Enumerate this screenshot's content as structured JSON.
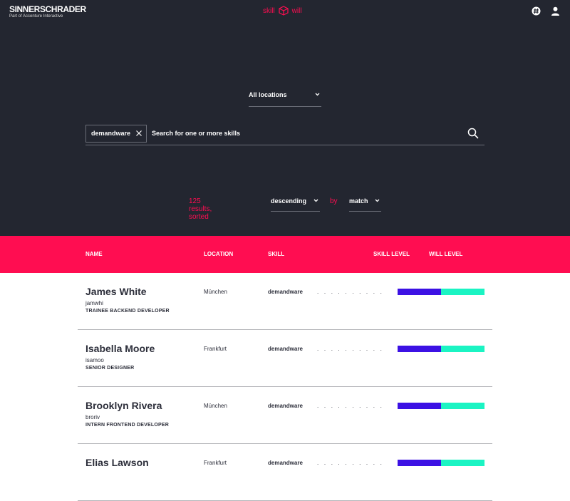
{
  "brand": {
    "name": "SINNERSCHRADER",
    "sub": "Part of Accenture Interactive"
  },
  "app_logo": {
    "left": "skill",
    "right": "will"
  },
  "filters": {
    "location": "All locations"
  },
  "search": {
    "tag": "demandware",
    "placeholder": "Search for one or more skills"
  },
  "results": {
    "count_text": "125 results, sorted",
    "direction": "descending",
    "by": "by",
    "key": "match"
  },
  "table": {
    "headers": {
      "name": "NAME",
      "location": "LOCATION",
      "skill": "SKILL",
      "skill_level": "SKILL LEVEL",
      "will_level": "WILL LEVEL"
    },
    "dots": ". . . . . . . . . .",
    "rows": [
      {
        "name": "James White",
        "handle": "jamwhi",
        "title": "TRAINEE BACKEND DEVELOPER",
        "location": "München",
        "skill": "demandware",
        "skill_level": 0.5,
        "will_level": 0.5
      },
      {
        "name": "Isabella Moore",
        "handle": "isamoo",
        "title": "SENIOR DESIGNER",
        "location": "Frankfurt",
        "skill": "demandware",
        "skill_level": 0.5,
        "will_level": 0.5
      },
      {
        "name": "Brooklyn Rivera",
        "handle": "broriv",
        "title": "INTERN FRONTEND DEVELOPER",
        "location": "München",
        "skill": "demandware",
        "skill_level": 0.5,
        "will_level": 0.5
      },
      {
        "name": "Elias Lawson",
        "handle": "",
        "title": "",
        "location": "Frankfurt",
        "skill": "demandware",
        "skill_level": 0.5,
        "will_level": 0.5
      }
    ]
  },
  "colors": {
    "accent": "#ff0d51",
    "dark_bg": "#232630",
    "skill_bar": "#3c11e4",
    "will_bar": "#1bf4c3"
  }
}
